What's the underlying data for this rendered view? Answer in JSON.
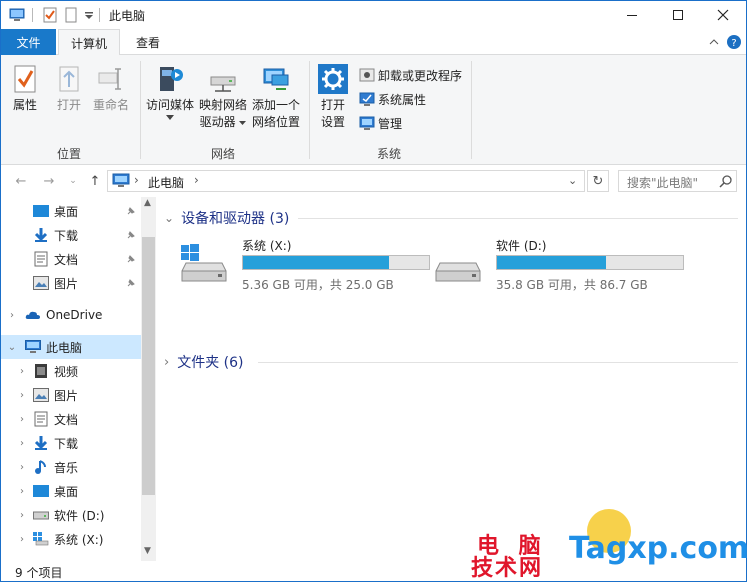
{
  "window": {
    "title": "此电脑"
  },
  "title_controls": [
    "minimize-icon",
    "maximize-icon",
    "close-icon"
  ],
  "ribbon_tabs": [
    {
      "label": "文件"
    },
    {
      "label": "计算机",
      "active": true
    },
    {
      "label": "查看"
    }
  ],
  "ribbon": {
    "groups": {
      "location": {
        "label": "位置",
        "buttons": [
          {
            "label": "属性",
            "icon": "properties-icon"
          },
          {
            "label": "打开",
            "icon": "open-icon"
          },
          {
            "label": "重命名",
            "icon": "rename-icon"
          }
        ]
      },
      "network": {
        "label": "网络",
        "buttons": [
          {
            "label": "访问媒体",
            "icon": "media-icon"
          },
          {
            "label": "映射网络",
            "label2": "驱动器",
            "icon": "map-drive-icon"
          },
          {
            "label": "添加一个",
            "label2": "网络位置",
            "icon": "network-location-icon"
          }
        ]
      },
      "system": {
        "label": "系统",
        "big": {
          "label": "打开",
          "label2": "设置",
          "icon": "settings-icon"
        },
        "small": [
          {
            "label": "卸载或更改程序",
            "icon": "uninstall-icon"
          },
          {
            "label": "系统属性",
            "icon": "system-properties-icon"
          },
          {
            "label": "管理",
            "icon": "manage-icon"
          }
        ]
      }
    }
  },
  "address": {
    "path": "此电脑",
    "search_placeholder": "搜索\"此电脑\""
  },
  "nav_pane": {
    "quick_access": [
      {
        "label": "桌面",
        "icon": "desktop-icon",
        "pinned": true
      },
      {
        "label": "下载",
        "icon": "download-icon",
        "pinned": true
      },
      {
        "label": "文档",
        "icon": "document-icon",
        "pinned": true
      },
      {
        "label": "图片",
        "icon": "picture-icon",
        "pinned": true
      }
    ],
    "onedrive": "OneDrive",
    "this_pc": "此电脑",
    "this_pc_children": [
      {
        "label": "视频",
        "icon": "video-icon"
      },
      {
        "label": "图片",
        "icon": "picture-icon"
      },
      {
        "label": "文档",
        "icon": "document-icon"
      },
      {
        "label": "下载",
        "icon": "download-icon"
      },
      {
        "label": "音乐",
        "icon": "music-icon"
      },
      {
        "label": "桌面",
        "icon": "desktop-icon"
      },
      {
        "label": "软件 (D:)",
        "icon": "drive-icon"
      },
      {
        "label": "系统 (X:)",
        "icon": "system-drive-icon"
      }
    ]
  },
  "content": {
    "devices_header": "设备和驱动器 (3)",
    "folders_header": "文件夹 (6)",
    "drives": [
      {
        "name": "系统 (X:)",
        "size_text": "5.36 GB 可用，共 25.0 GB",
        "used_fraction": 0.786,
        "icon": "windows-drive-icon"
      },
      {
        "name": "软件 (D:)",
        "size_text": "35.8 GB 可用，共 86.7 GB",
        "used_fraction": 0.587,
        "icon": "drive-icon"
      }
    ]
  },
  "status": {
    "text": "9 个项目"
  },
  "watermark": {
    "line1": "电 脑",
    "line2": "技术网",
    "en": "Tagxp.com"
  },
  "colors": {
    "accent": "#1979ca",
    "selection": "#cce8ff",
    "bar_fill": "#26a0da",
    "group_header": "#1e3287"
  }
}
